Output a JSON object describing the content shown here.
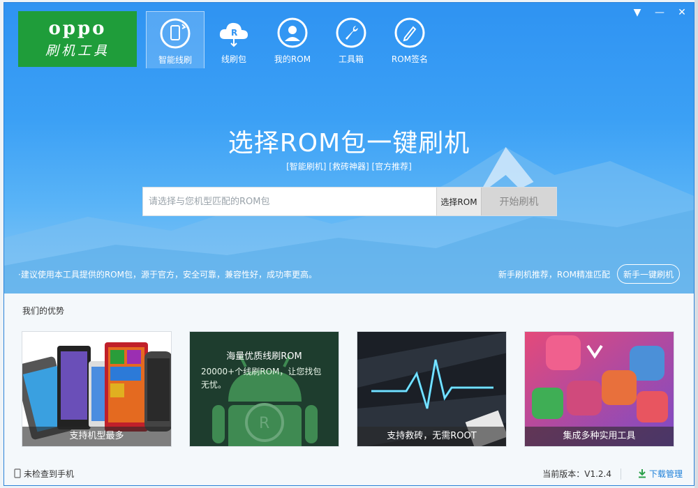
{
  "app": {
    "logo_brand": "oppo",
    "logo_sub": "刷机工具"
  },
  "nav": [
    {
      "label": "智能线刷",
      "icon": "phone-refresh-icon",
      "active": true
    },
    {
      "label": "线刷包",
      "icon": "cloud-rom-icon",
      "active": false
    },
    {
      "label": "我的ROM",
      "icon": "user-icon",
      "active": false
    },
    {
      "label": "工具箱",
      "icon": "wrench-icon",
      "active": false
    },
    {
      "label": "ROM签名",
      "icon": "pen-icon",
      "active": false
    }
  ],
  "window_controls": {
    "menu": "▼",
    "minimize": "—",
    "close": "✕"
  },
  "hero": {
    "headline": "选择ROM包一键刷机",
    "tags": "[智能刷机] [救砖神器] [官方推荐]",
    "search_placeholder": "请选择与您机型匹配的ROM包",
    "select_rom_label": "选择ROM",
    "start_flash_label": "开始刷机",
    "tip": "·建议使用本工具提供的ROM包，源于官方，安全可靠，兼容性好，成功率更高。",
    "recommend_text": "新手刷机推荐，ROM精准匹配",
    "newbie_button": "新手一键刷机"
  },
  "advantages": {
    "title": "我们的优势",
    "cards": [
      {
        "caption": "支持机型最多",
        "image": "phones"
      },
      {
        "caption": "",
        "title": "海量优质线刷ROM",
        "desc": "20000+个线刷ROM，让您找包无忧。",
        "image": "android"
      },
      {
        "caption": "支持救砖，无需ROOT",
        "image": "pulse"
      },
      {
        "caption": "集成多种实用工具",
        "image": "apps"
      }
    ]
  },
  "status": {
    "device": "未检查到手机",
    "version": "当前版本：V1.2.4",
    "download": "下载管理"
  },
  "colors": {
    "accent": "#2f93f2",
    "logo_green": "#1f9d3a",
    "link": "#1b7fd9"
  }
}
